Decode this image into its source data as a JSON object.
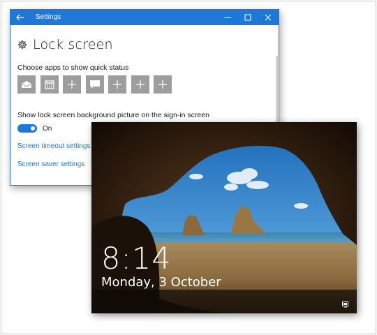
{
  "window": {
    "title": "Settings",
    "controls": {
      "back": "back-arrow-icon",
      "minimize": "minimize-icon",
      "maximize": "maximize-icon",
      "close": "close-icon"
    }
  },
  "page": {
    "title": "Lock screen",
    "icon": "gear-icon"
  },
  "quick_status": {
    "label": "Choose apps to show quick status",
    "apps": [
      "mail-icon",
      "calendar-icon",
      "plus-icon",
      "message-icon",
      "plus-icon",
      "plus-icon",
      "plus-icon"
    ]
  },
  "signin": {
    "label": "Show lock screen background picture on the sign-in screen",
    "toggle_state": "On"
  },
  "links": {
    "timeout": "Screen timeout settings",
    "saver": "Screen saver settings"
  },
  "colors": {
    "accent": "#1e78d7",
    "tile": "#9d9d9d"
  },
  "lockscreen": {
    "time": "8:14",
    "date": "Monday, 3 October",
    "status_icon": "network-icon"
  }
}
